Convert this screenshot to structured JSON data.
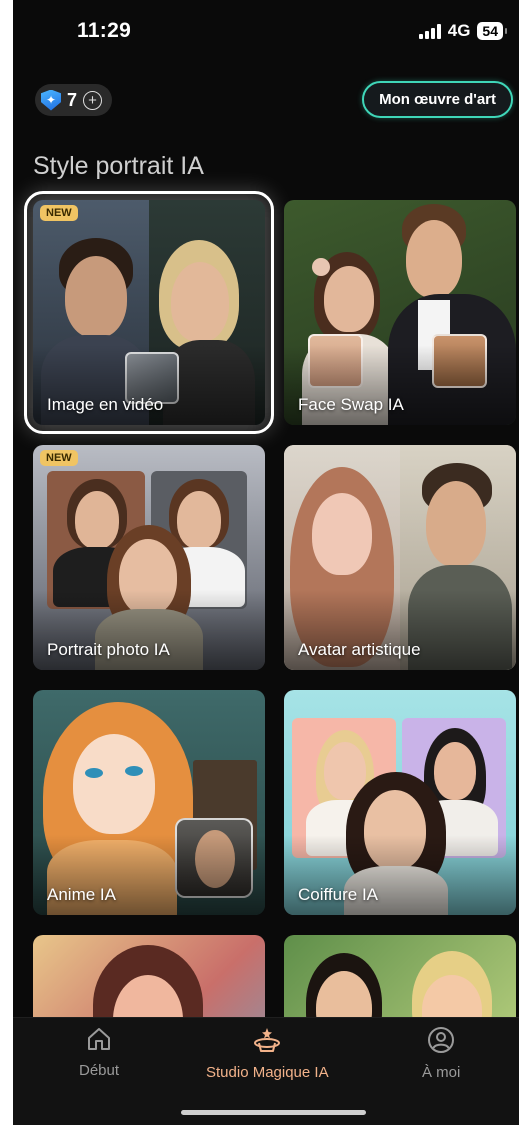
{
  "status": {
    "time": "11:29",
    "network": "4G",
    "battery": "54"
  },
  "header": {
    "credits": "7",
    "artwork_button": "Mon œuvre d'art"
  },
  "section": {
    "title": "Style portrait IA"
  },
  "cards": [
    {
      "label": "Image en vidéo",
      "badge": "NEW"
    },
    {
      "label": "Face Swap IA"
    },
    {
      "label": "Portrait photo IA",
      "badge": "NEW"
    },
    {
      "label": "Avatar artistique"
    },
    {
      "label": "Anime IA"
    },
    {
      "label": "Coiffure IA"
    },
    {
      "label": ""
    },
    {
      "label": ""
    }
  ],
  "nav": {
    "items": [
      {
        "label": "Début",
        "icon": "home-icon"
      },
      {
        "label": "Studio Magique IA",
        "icon": "magic-hat-icon"
      },
      {
        "label": "À moi",
        "icon": "profile-icon"
      }
    ],
    "active_color": "#f2b28a"
  },
  "colors": {
    "accent": "#3fd6b8",
    "badge": "#f0c463",
    "background": "#0a0a0a"
  }
}
